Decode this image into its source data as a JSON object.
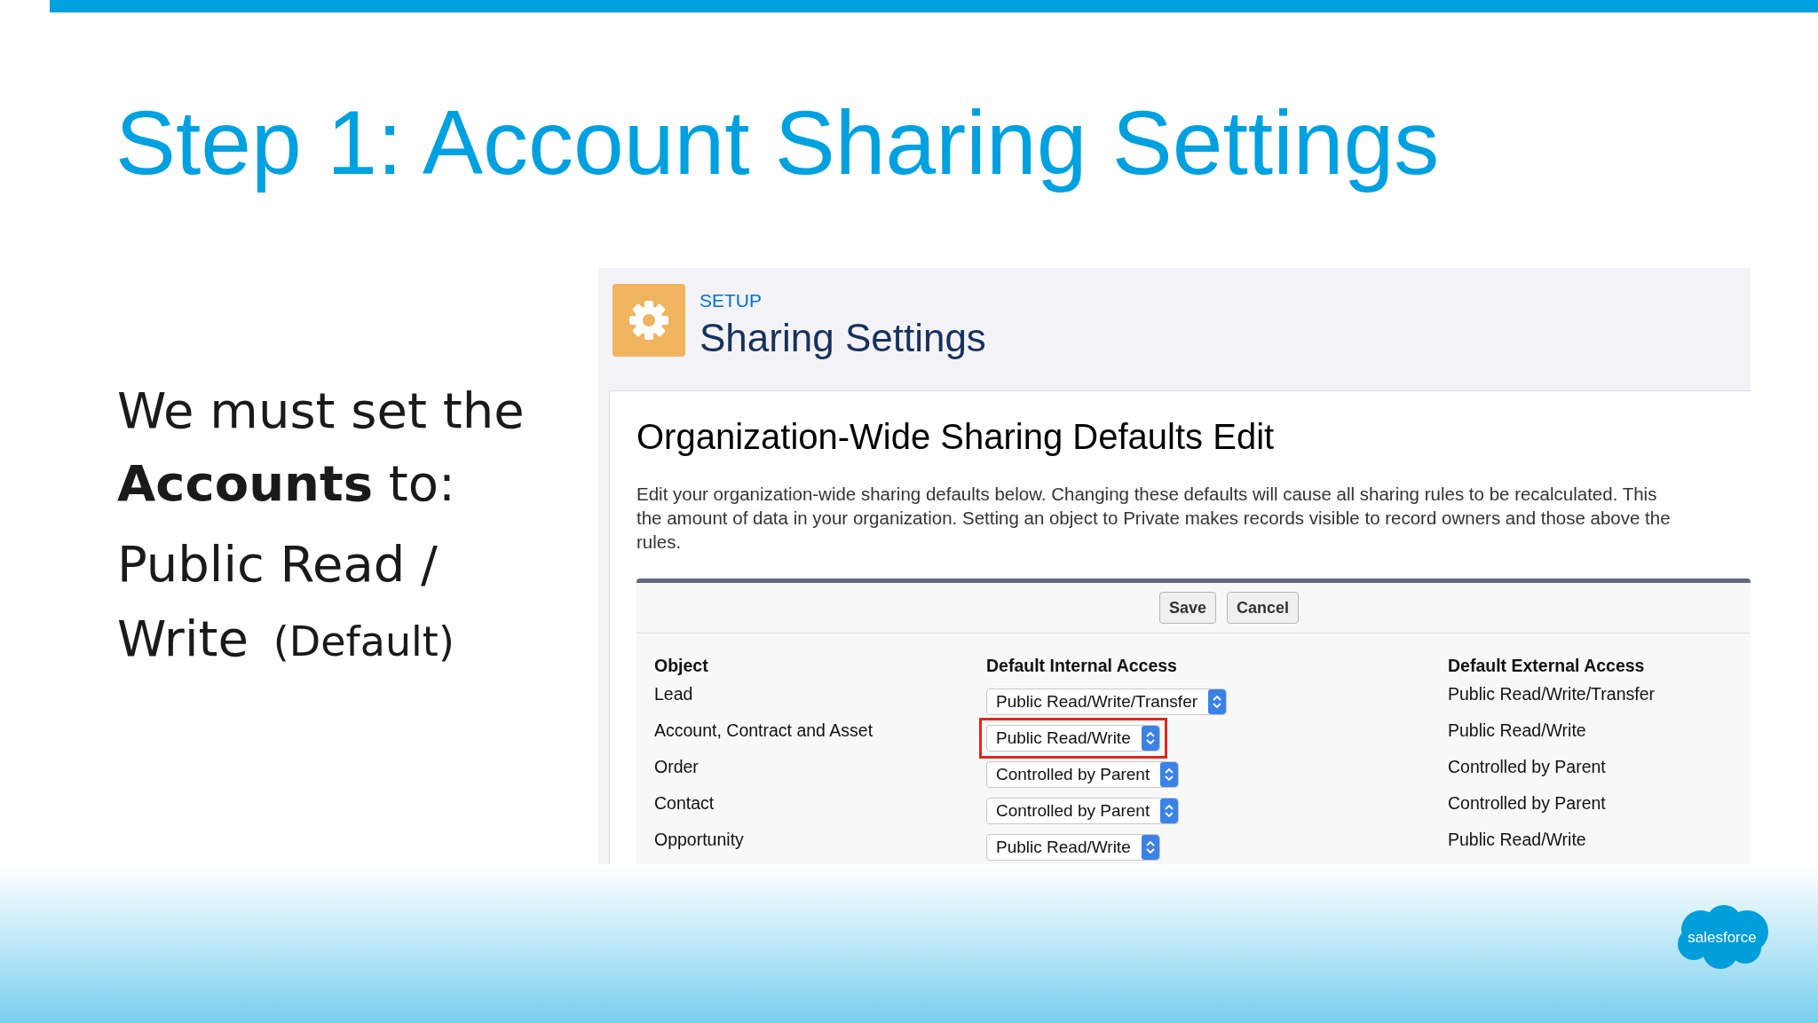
{
  "slide": {
    "title": "Step 1: Account Sharing Settings",
    "statement": "We must set the **Accounts** to:",
    "value": "Public Read / Write",
    "note": "(Default)",
    "logo": "salesforce"
  },
  "screenshot": {
    "eyebrow": "SETUP",
    "page_title": "Sharing Settings",
    "card_title": "Organization-Wide Sharing Defaults Edit",
    "description_lines": [
      "Edit your organization-wide sharing defaults below. Changing these defaults will cause all sharing rules to be recalculated. This",
      "the amount of data in your organization. Setting an object to Private makes records visible to record owners and those above the",
      "rules."
    ],
    "buttons": [
      "Save",
      "Cancel"
    ],
    "columns": [
      "Object",
      "Default Internal Access",
      "Default External Access"
    ],
    "rows": [
      {
        "object": "Lead",
        "internal": "Public Read/Write/Transfer",
        "external": "Public Read/Write/Transfer",
        "highlighted": false
      },
      {
        "object": "Account, Contract and Asset",
        "internal": "Public Read/Write",
        "external": "Public Read/Write",
        "highlighted": true
      },
      {
        "object": "Order",
        "internal": "Controlled by Parent",
        "external": "Controlled by Parent",
        "highlighted": false
      },
      {
        "object": "Contact",
        "internal": "Controlled by Parent",
        "external": "Controlled by Parent",
        "highlighted": false
      },
      {
        "object": "Opportunity",
        "internal": "Public Read/Write",
        "external": "Public Read/Write",
        "highlighted": false
      }
    ]
  }
}
